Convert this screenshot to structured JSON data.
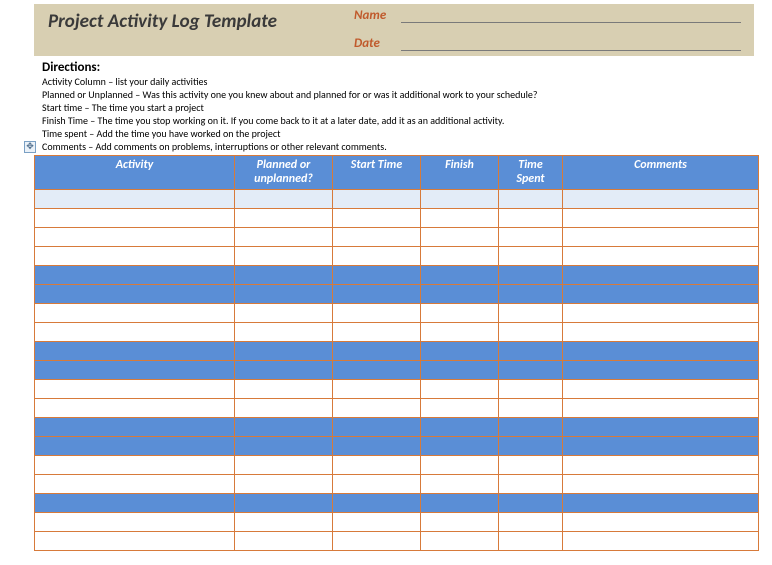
{
  "header": {
    "title": "Project Activity Log Template",
    "name_label": "Name",
    "name_value": "",
    "date_label": "Date",
    "date_value": ""
  },
  "directions": {
    "heading": "Directions:",
    "lines": [
      "Activity Column – list your daily activities",
      "Planned or Unplanned – Was this activity one you knew about and planned for or was it additional work to your schedule?",
      "Start time – The time you start a project",
      "Finish Time – The time you stop working on it.  If you come back to it at a later date, add it as an additional activity.",
      "Time spent – Add the time you have worked on the project",
      "Comments – Add comments on problems, interruptions or other relevant comments."
    ]
  },
  "table": {
    "headers": {
      "activity": "Activity",
      "planned": "Planned or unplanned?",
      "start": "Start Time",
      "finish": "Finish",
      "time": "Time Spent",
      "comments": "Comments"
    },
    "row_styles": [
      "lightblue",
      "white",
      "white",
      "white",
      "blue",
      "blue",
      "white",
      "white",
      "blue",
      "blue",
      "white",
      "white",
      "blue",
      "blue",
      "white",
      "white",
      "blue",
      "white",
      "white"
    ]
  },
  "chart_data": {
    "type": "table",
    "title": "Project Activity Log Template",
    "columns": [
      "Activity",
      "Planned or unplanned?",
      "Start Time",
      "Finish",
      "Time Spent",
      "Comments"
    ],
    "rows": []
  }
}
